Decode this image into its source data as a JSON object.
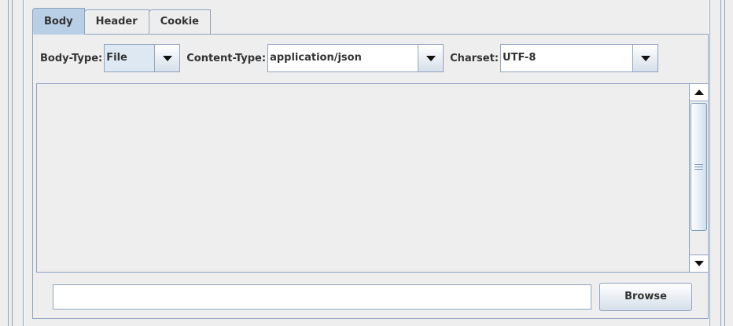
{
  "tabs": [
    {
      "label": "Body",
      "active": true
    },
    {
      "label": "Header",
      "active": false
    },
    {
      "label": "Cookie",
      "active": false
    }
  ],
  "toolbar": {
    "body_type_label": "Body-Type:",
    "body_type_value": "File",
    "content_type_label": "Content-Type:",
    "content_type_value": "application/json",
    "charset_label": "Charset:",
    "charset_value": "UTF-8"
  },
  "file": {
    "path_value": "",
    "browse_label": "Browse"
  },
  "colors": {
    "background": "#eeeeee",
    "border": "#8ea4c0",
    "active_tab": "#b8cfe5"
  }
}
